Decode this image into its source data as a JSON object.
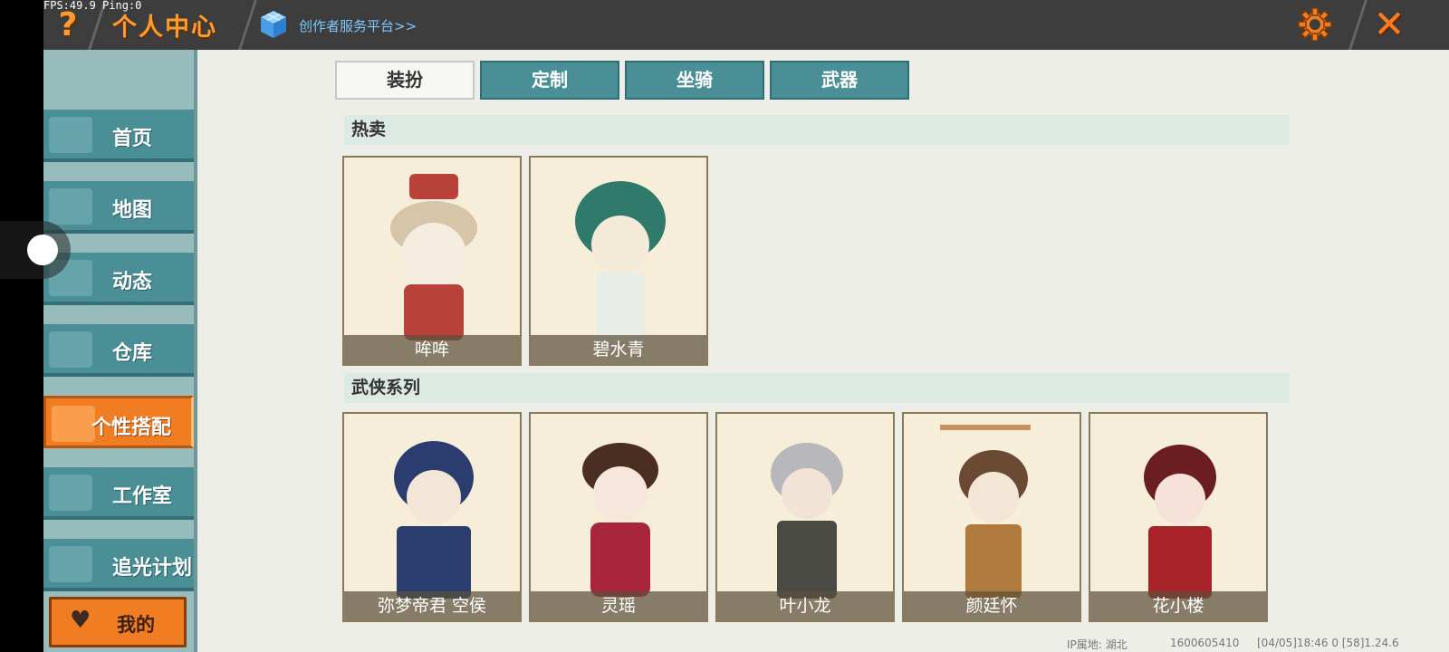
{
  "debug": {
    "fps": "FPS:49.9  Ping:0"
  },
  "header": {
    "help_icon": "question-icon",
    "title": "个人中心",
    "creator_link": "创作者服务平台>>",
    "settings_icon": "gear-icon",
    "close_icon": "close-icon"
  },
  "sidebar": {
    "items": [
      {
        "label": "首页"
      },
      {
        "label": "地图"
      },
      {
        "label": "动态"
      },
      {
        "label": "仓库"
      },
      {
        "label": "个性搭配"
      },
      {
        "label": "工作室"
      },
      {
        "label": "追光计划"
      }
    ],
    "active_index": 4,
    "mine_label": "我的"
  },
  "tabs": [
    {
      "label": "装扮"
    },
    {
      "label": "定制"
    },
    {
      "label": "坐骑"
    },
    {
      "label": "武器"
    }
  ],
  "sections": [
    {
      "title": "热卖",
      "cards": [
        {
          "name": "哞哞",
          "color": "#b8413a"
        },
        {
          "name": "碧水青",
          "color": "#2f7a6a"
        }
      ]
    },
    {
      "title": "武侠系列",
      "cards": [
        {
          "name": "弥梦帝君 空侯",
          "color": "#2b3d6e"
        },
        {
          "name": "灵瑶",
          "color": "#a8263a"
        },
        {
          "name": "叶小龙",
          "color": "#4a4a44"
        },
        {
          "name": "颜廷怀",
          "color": "#b07a3e"
        },
        {
          "name": "花小楼",
          "color": "#a8222a"
        }
      ]
    }
  ],
  "footer": {
    "ip": "IP属地: 湖北",
    "uid": "1600605410",
    "version": "[04/05]18:46 0  [58]1.24.6"
  }
}
